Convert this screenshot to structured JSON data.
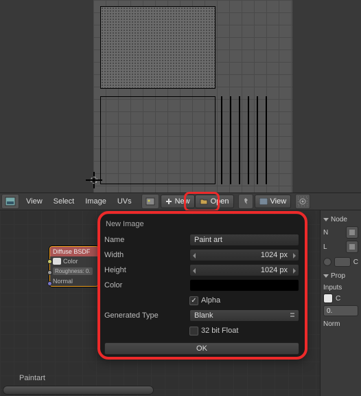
{
  "header": {
    "menus": [
      "View",
      "Select",
      "Image",
      "UVs"
    ],
    "new_btn": "New",
    "open_btn": "Open",
    "view_btn": "View"
  },
  "popup": {
    "title": "New Image",
    "name_label": "Name",
    "name_value": "Paint art",
    "width_label": "Width",
    "width_value": "1024 px",
    "height_label": "Height",
    "height_value": "1024 px",
    "color_label": "Color",
    "alpha_label": "Alpha",
    "gentype_label": "Generated Type",
    "gentype_value": "Blank",
    "float_label": "32 bit Float",
    "ok_label": "OK"
  },
  "node": {
    "title": "Diffuse BSDF",
    "color_label": "Color",
    "roughness_label": "Roughness: 0.",
    "normal_label": "Normal"
  },
  "right": {
    "node_section": "Node",
    "n_label": "N",
    "l_label": "L",
    "c_label": "C",
    "prop_section": "Prop",
    "inputs_label": "Inputs",
    "c2_label": "C",
    "zero_value": "0.",
    "norm_label": "Norm"
  },
  "footer": {
    "label": "Paintart"
  }
}
